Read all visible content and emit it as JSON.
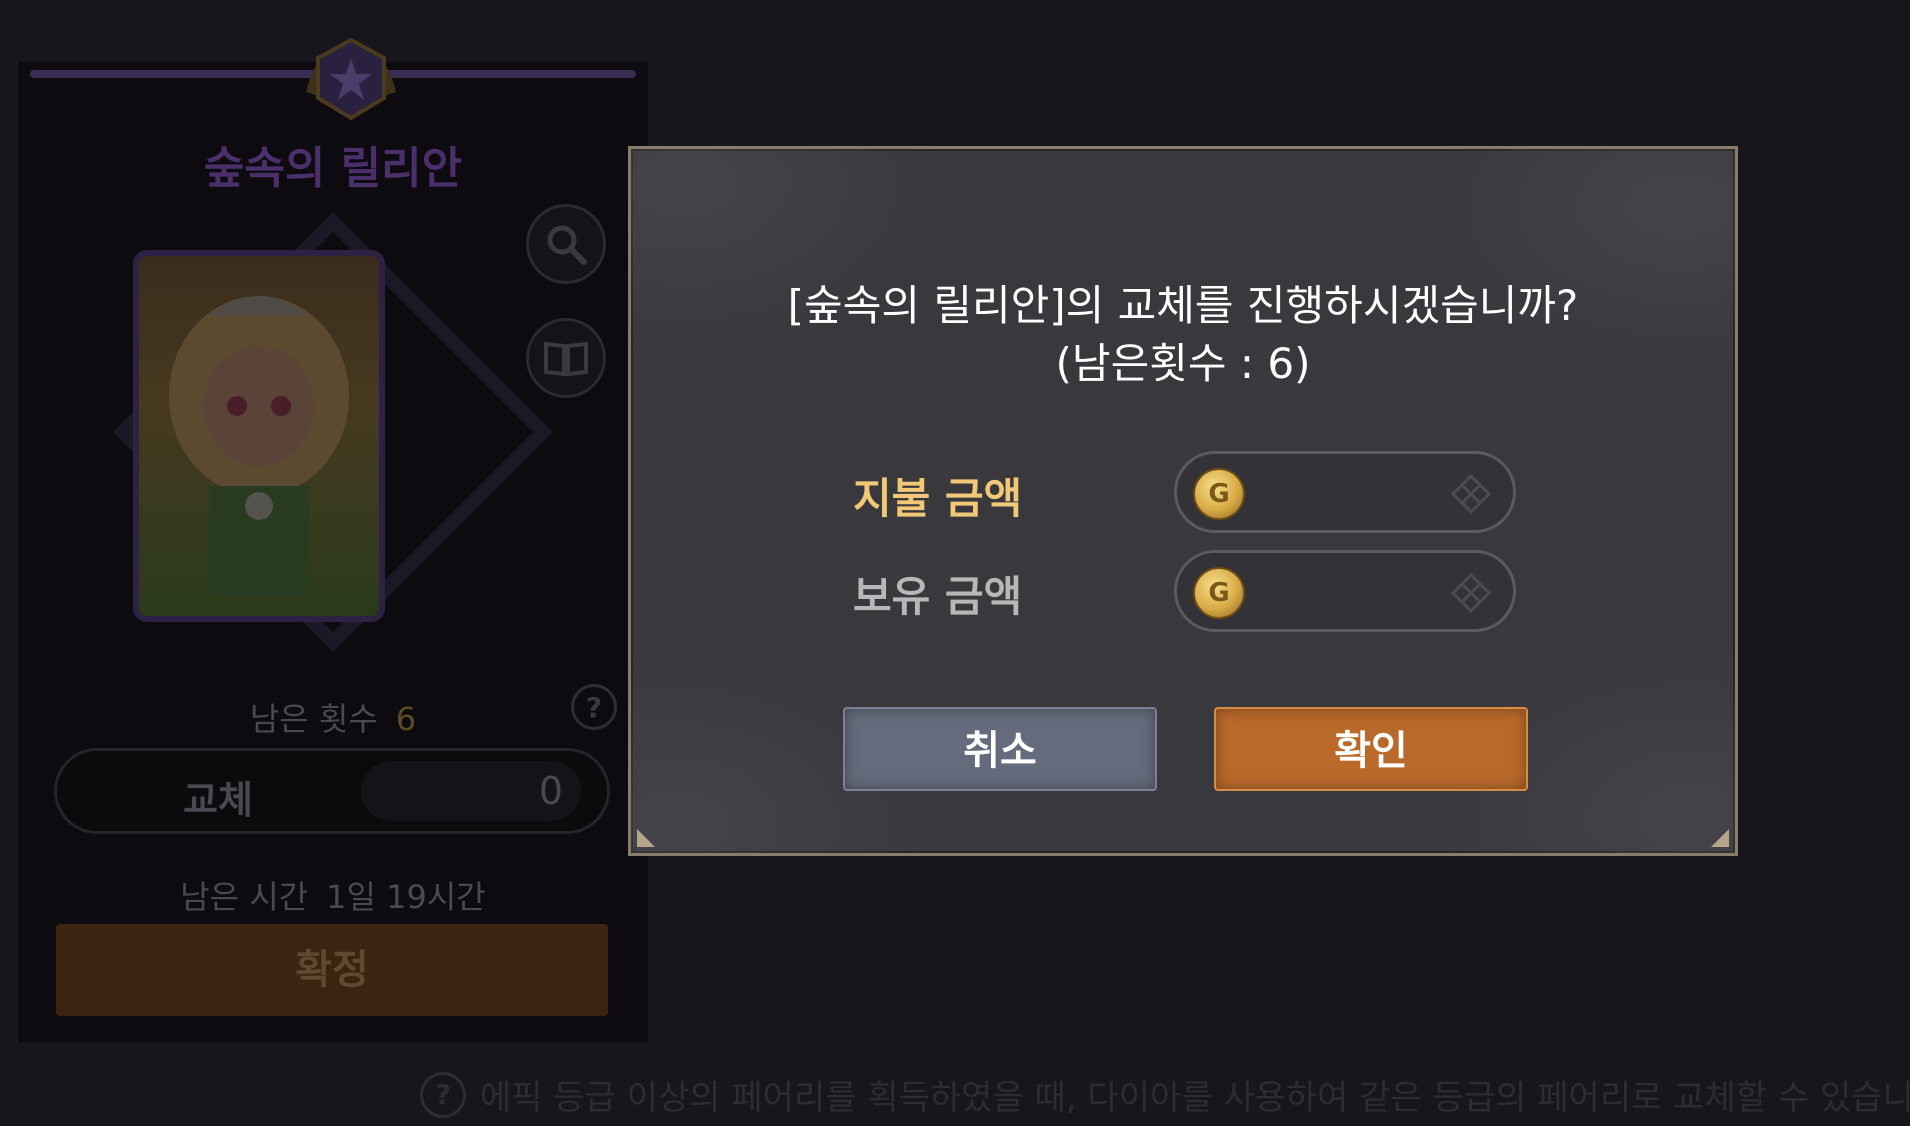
{
  "background_panel": {
    "character_name": "숲속의 릴리안",
    "remaining_label": "남은 횟수",
    "remaining_value": "6",
    "swap_label": "교체",
    "swap_cost": "0",
    "time_label": "남은 시간",
    "time_value": "1일 19시간",
    "confirm_label": "확정",
    "help_glyph": "?"
  },
  "bottom_notice": {
    "help_glyph": "?",
    "text": "에픽 등급 이상의 페어리를 획득하였을 때, 다이아를 사용하여 같은 등급의 페어리로 교체할 수 있습니다"
  },
  "dialog": {
    "message_line1": "[숲속의 릴리안]의 교체를 진행하시겠습니까?",
    "message_line2": "(남은횟수 : 6)",
    "pay_label": "지불 금액",
    "own_label": "보유 금액",
    "coin_glyph": "G",
    "cancel_label": "취소",
    "ok_label": "확인"
  },
  "colors": {
    "pay_label": "#f0c877",
    "own_label": "#b9b6b8",
    "ok_button": "#b9692a",
    "cancel_button": "#656a7c"
  }
}
